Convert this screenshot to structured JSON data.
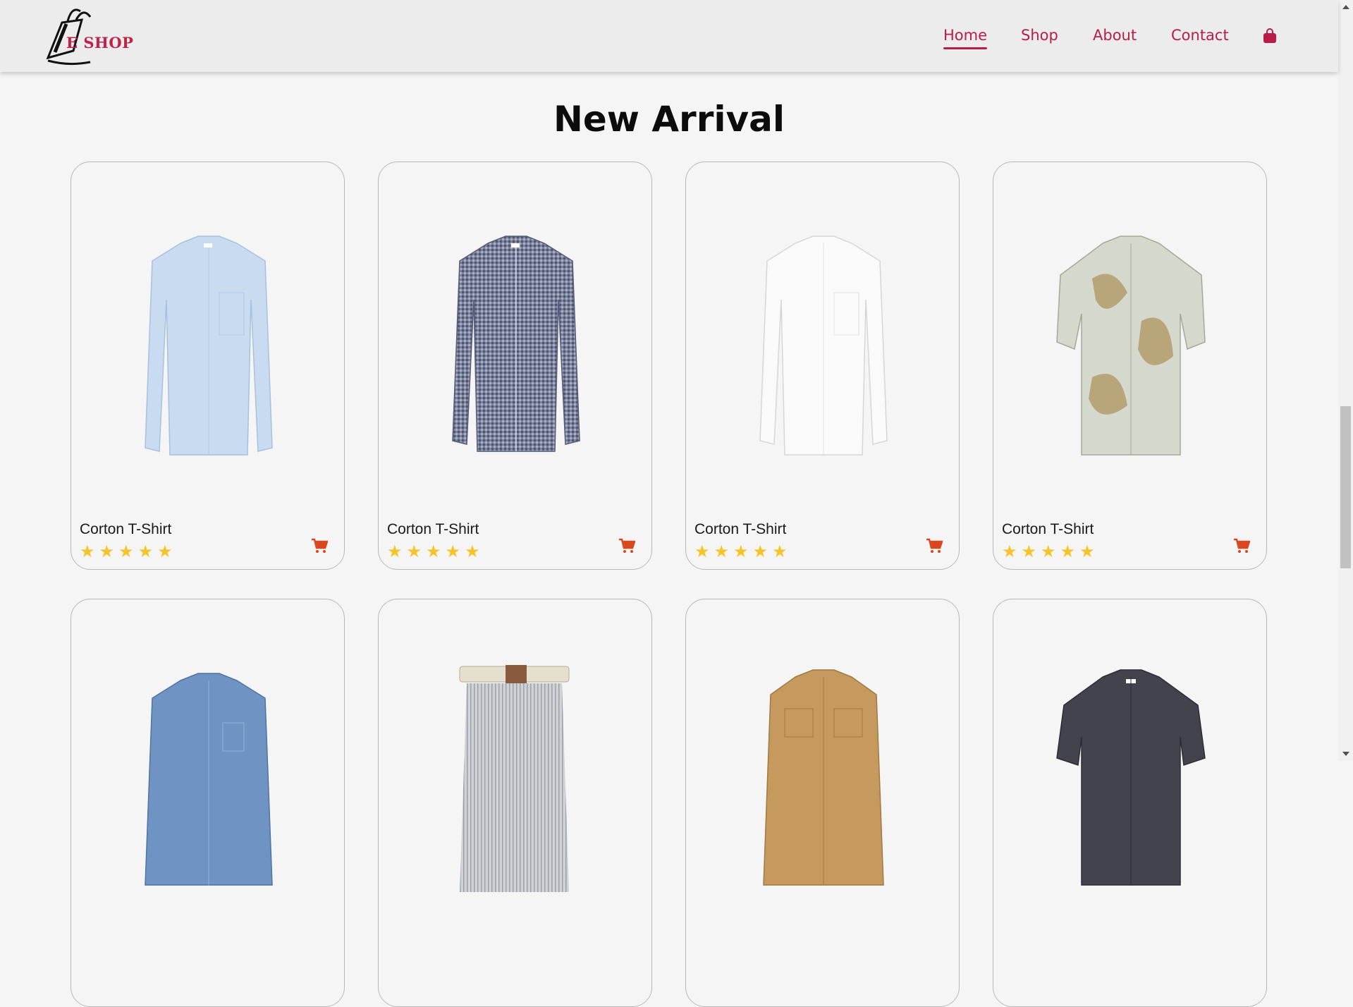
{
  "brand": {
    "logo_text": "E SHOP"
  },
  "nav": {
    "items": [
      {
        "label": "Home",
        "active": true
      },
      {
        "label": "Shop",
        "active": false
      },
      {
        "label": "About",
        "active": false
      },
      {
        "label": "Contact",
        "active": false
      }
    ],
    "cart_icon": "shopping-bag-icon"
  },
  "section": {
    "title": "New Arrival"
  },
  "products": [
    {
      "name": "Corton T-Shirt",
      "rating": 5,
      "image": "light-blue-shirt"
    },
    {
      "name": "Corton T-Shirt",
      "rating": 5,
      "image": "navy-gingham-shirt"
    },
    {
      "name": "Corton T-Shirt",
      "rating": 5,
      "image": "white-shirt"
    },
    {
      "name": "Corton T-Shirt",
      "rating": 5,
      "image": "printed-short-sleeve-shirt"
    },
    {
      "name": "",
      "rating": 0,
      "image": "denim-shirt"
    },
    {
      "name": "",
      "rating": 0,
      "image": "striped-trousers"
    },
    {
      "name": "",
      "rating": 0,
      "image": "tan-overshirt"
    },
    {
      "name": "",
      "rating": 0,
      "image": "charcoal-short-sleeve-shirt"
    }
  ],
  "colors": {
    "accent": "#b81d48",
    "star": "#f6c42a",
    "cart": "#d9481c"
  }
}
